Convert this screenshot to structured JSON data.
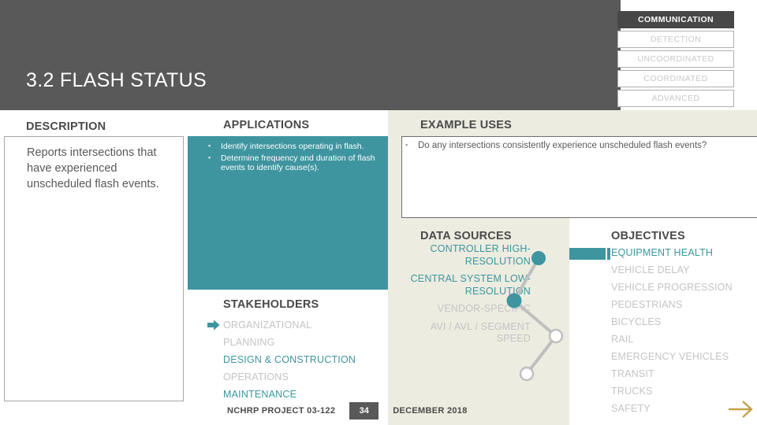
{
  "header": {
    "title": "3.2 FLASH STATUS",
    "band_color": "#595959"
  },
  "level_badges": {
    "items": [
      {
        "label": "COMMUNICATION",
        "state": "active"
      },
      {
        "label": "DETECTION",
        "state": "inactive"
      },
      {
        "label": "UNCOORDINATED",
        "state": "inactive"
      },
      {
        "label": "COORDINATED",
        "state": "inactive"
      },
      {
        "label": "ADVANCED",
        "state": "inactive"
      }
    ]
  },
  "sections": {
    "description_heading": "DESCRIPTION",
    "applications_heading": "APPLICATIONS",
    "example_uses_heading": "EXAMPLE USES",
    "data_sources_heading": "DATA SOURCES",
    "objectives_heading": "OBJECTIVES",
    "stakeholders_heading": "STAKEHOLDERS"
  },
  "description": {
    "text": "Reports intersections that have experienced unscheduled flash events."
  },
  "applications": {
    "items": [
      "Identify intersections operating in flash.",
      "Determine frequency and duration of flash events to identify cause(s)."
    ]
  },
  "example_uses": {
    "items": [
      "Do any intersections consistently experience unscheduled flash events?"
    ]
  },
  "stakeholders": {
    "items": [
      {
        "label": "ORGANIZATIONAL",
        "active": false
      },
      {
        "label": "PLANNING",
        "active": false
      },
      {
        "label": "DESIGN & CONSTRUCTION",
        "active": true
      },
      {
        "label": "OPERATIONS",
        "active": false
      },
      {
        "label": "MAINTENANCE",
        "active": true
      }
    ]
  },
  "data_sources": {
    "items": [
      {
        "label": "CONTROLLER HIGH-RESOLUTION",
        "active": true
      },
      {
        "label": "CENTRAL SYSTEM LOW-RESOLUTION",
        "active": true
      },
      {
        "label": "VENDOR-SPECIFIC",
        "active": false
      },
      {
        "label": "AVI / AVL / SEGMENT SPEED",
        "active": false
      }
    ]
  },
  "objectives": {
    "items": [
      {
        "label": "EQUIPMENT HEALTH",
        "active": true
      },
      {
        "label": "VEHICLE DELAY",
        "active": false
      },
      {
        "label": "VEHICLE PROGRESSION",
        "active": false
      },
      {
        "label": "PEDESTRIANS",
        "active": false
      },
      {
        "label": "BICYCLES",
        "active": false
      },
      {
        "label": "RAIL",
        "active": false
      },
      {
        "label": "EMERGENCY VEHICLES",
        "active": false
      },
      {
        "label": "TRANSIT",
        "active": false
      },
      {
        "label": "TRUCKS",
        "active": false
      },
      {
        "label": "SAFETY",
        "active": false
      }
    ]
  },
  "footer": {
    "project": "NCHRP PROJECT 03-122",
    "page": "34",
    "date": "DECEMBER 2018"
  },
  "colors": {
    "teal": "#3e95a0",
    "beige": "#ecece0",
    "gray": "#595959",
    "muted": "#c4c4c4",
    "gold": "#c4a24a"
  }
}
